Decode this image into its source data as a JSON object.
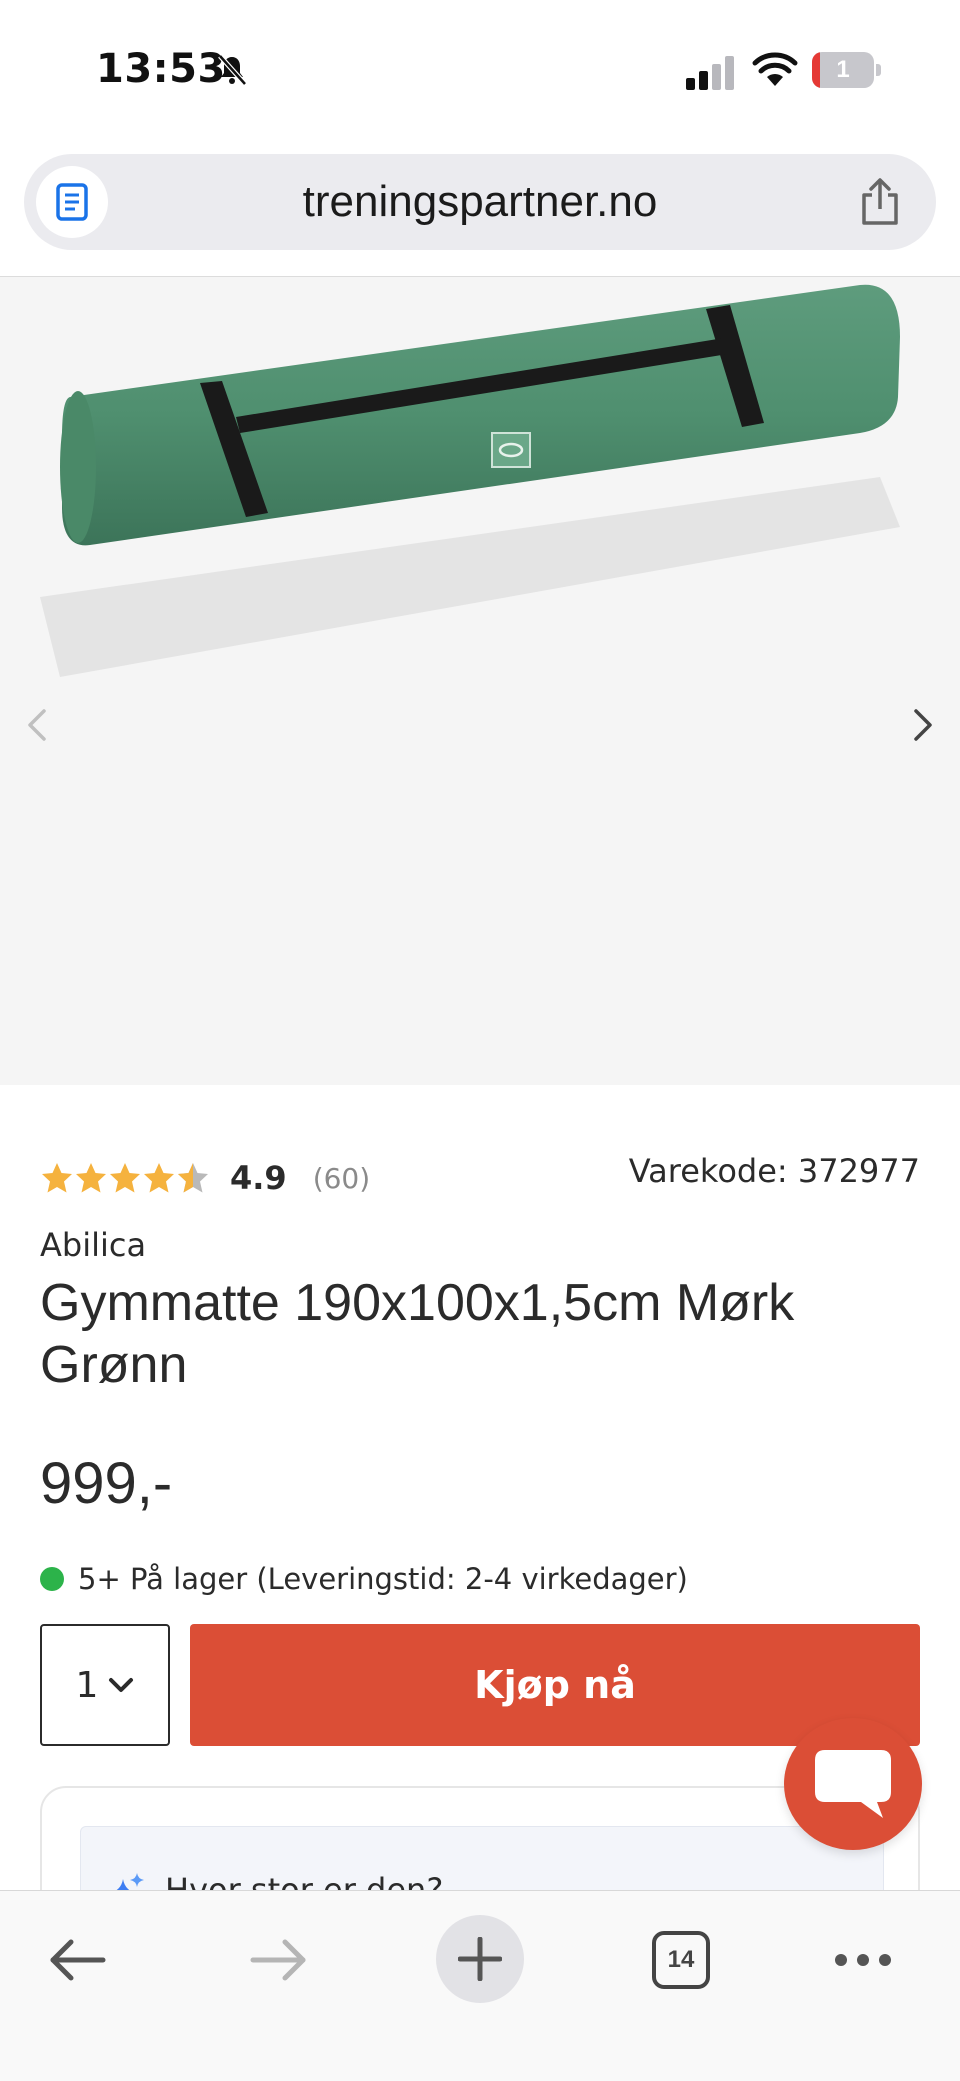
{
  "status_bar": {
    "time": "13:53",
    "battery_level": "1"
  },
  "browser": {
    "url": "treningspartner.no",
    "tab_count": "14"
  },
  "product": {
    "rating": "4.9",
    "rating_stars": 4.5,
    "review_count": "(60)",
    "sku_label": "Varekode: 372977",
    "brand": "Abilica",
    "title": "Gymmatte 190x100x1,5cm Mørk Grønn",
    "price": "999,-",
    "stock_text": "5+ På lager (Leveringstid: 2-4 virkedager)",
    "quantity": "1",
    "buy_label": "Kjøp nå",
    "qa_question": "Hvor stor er den?"
  },
  "colors": {
    "accent": "#db4e36",
    "stock_ok": "#2cb34a",
    "star": "#f5b23e",
    "mat_green": "#4f8f6f"
  }
}
